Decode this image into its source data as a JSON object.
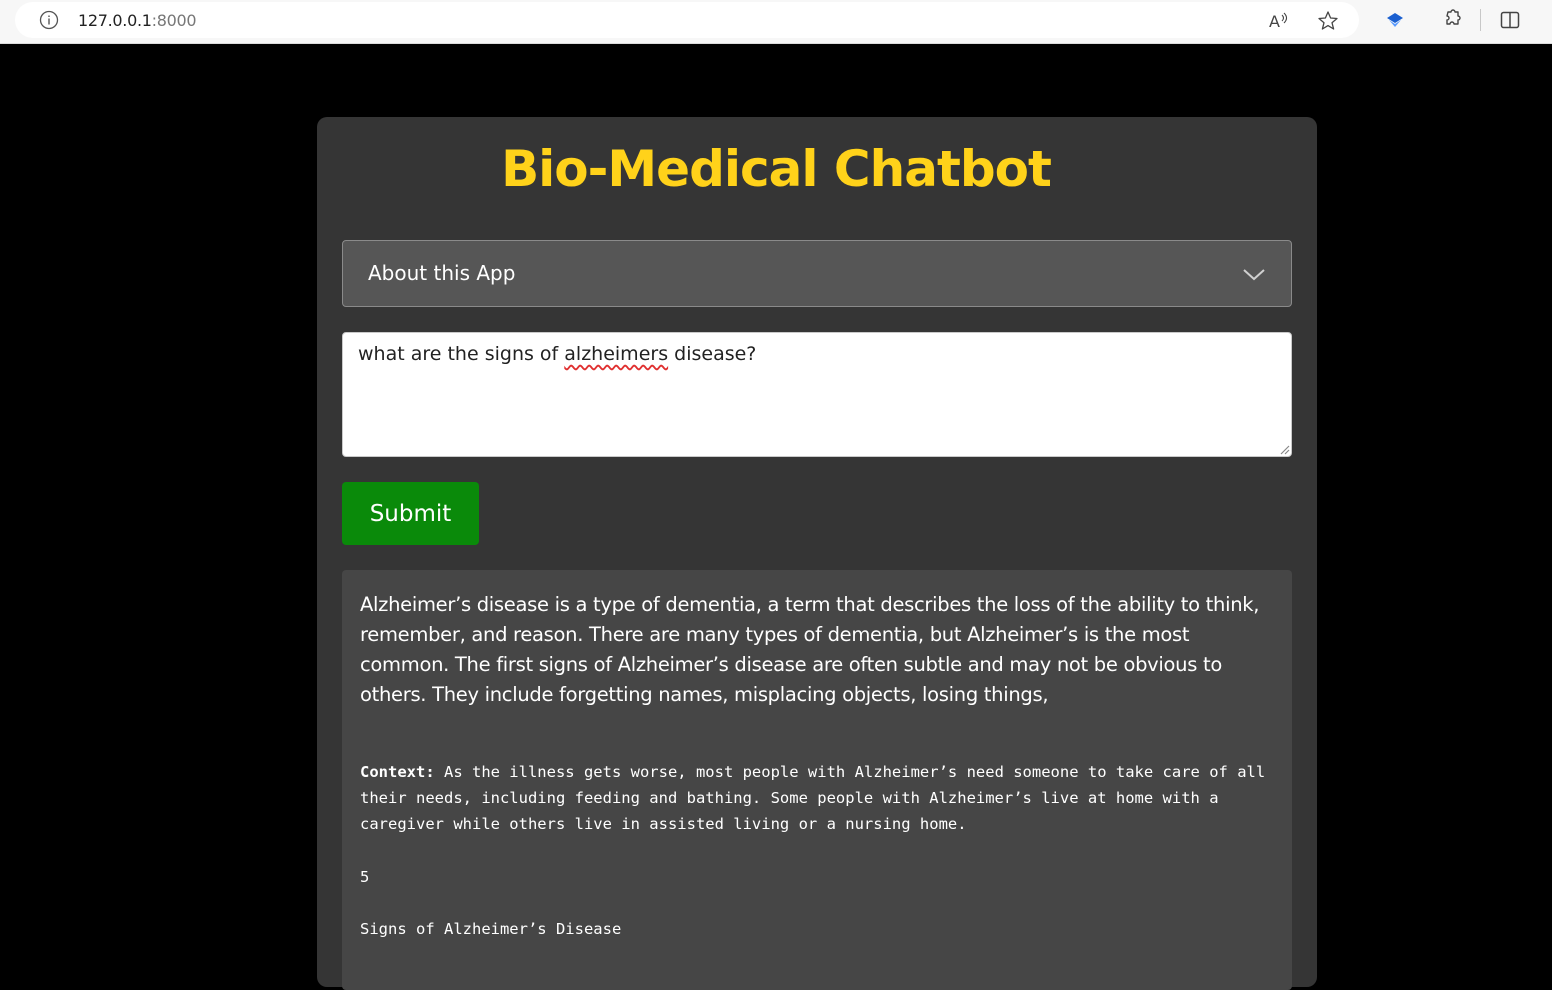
{
  "browser": {
    "url_host": "127.0.0.1",
    "url_port": ":8000"
  },
  "app": {
    "title": "Bio-Medical Chatbot",
    "expander_label": "About this App",
    "query_before": "what are the signs of ",
    "query_misspelled": "alzheimers",
    "query_after": " disease?",
    "submit_label": "Submit"
  },
  "answer": {
    "text": "Alzheimer’s disease is a type of dementia, a term that describes the loss of the ability to think, remember, and reason. There are many types of dementia, but Alzheimer’s is the most common. The first signs of Alzheimer’s disease are often subtle and may not be obvious to others. They include forgetting names, misplacing objects, losing things,",
    "context_label": "Context:",
    "context_text": " As the illness gets worse, most people with Alzheimer’s need someone to take care of all their needs, including feeding and bathing. Some people with Alzheimer’s live at home with a caregiver while others live in assisted living or a nursing home.",
    "page_number": "5",
    "section_heading": "Signs of Alzheimer’s Disease"
  },
  "colors": {
    "title": "#ffd21a",
    "submit": "#0a8a0a",
    "card": "#353535",
    "answer_bg": "#464646"
  },
  "icons": [
    "info-icon",
    "read-aloud-icon",
    "favorite-star-icon",
    "extension-shield-icon",
    "extensions-puzzle-icon",
    "split-screen-icon",
    "chevron-down-icon"
  ]
}
